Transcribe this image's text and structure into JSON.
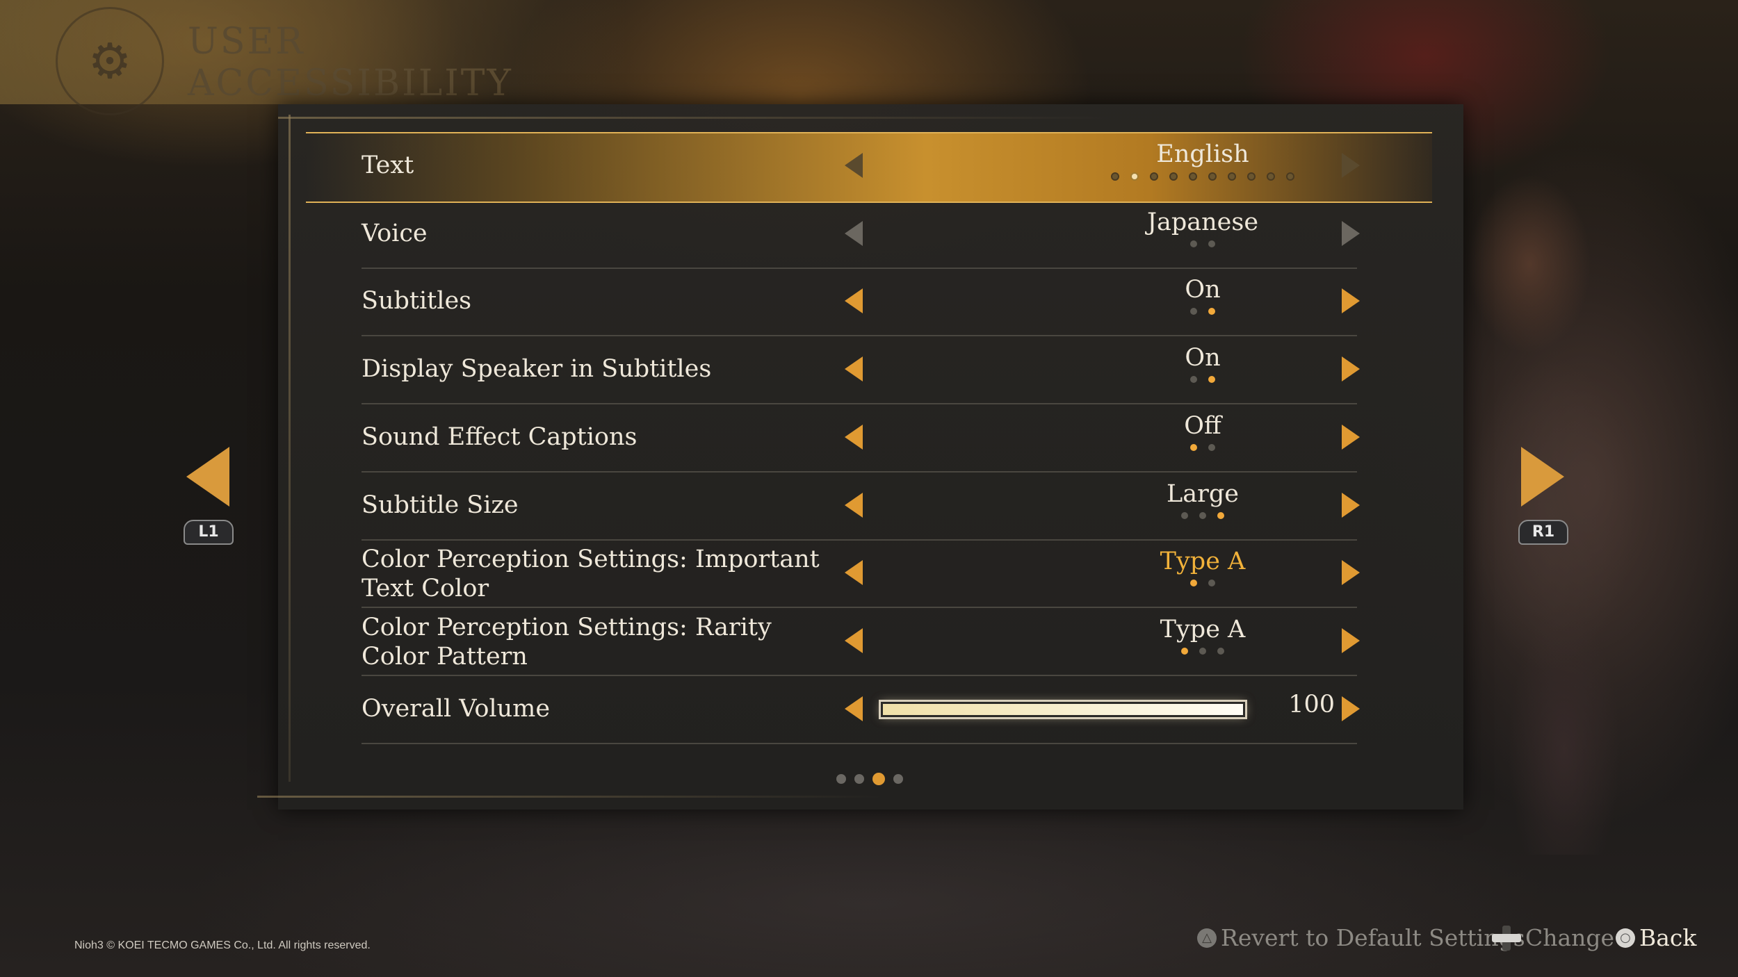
{
  "header": {
    "title": "USER ACCESSIBILITY",
    "emblem_icon": "gear-icon"
  },
  "settings": [
    {
      "label": "Text",
      "value": "English",
      "option_count": 10,
      "option_index": 1,
      "selected": true
    },
    {
      "label": "Voice",
      "value": "Japanese",
      "option_count": 2,
      "option_index": null,
      "selected": false,
      "dim": true
    },
    {
      "label": "Subtitles",
      "value": "On",
      "option_count": 2,
      "option_index": 1,
      "selected": false
    },
    {
      "label": "Display Speaker in Subtitles",
      "value": "On",
      "option_count": 2,
      "option_index": 1,
      "selected": false
    },
    {
      "label": "Sound Effect Captions",
      "value": "Off",
      "option_count": 2,
      "option_index": 0,
      "selected": false
    },
    {
      "label": "Subtitle Size",
      "value": "Large",
      "option_count": 3,
      "option_index": 2,
      "selected": false
    },
    {
      "label": "Color Perception Settings: Important Text Color",
      "value": "Type A",
      "option_count": 2,
      "option_index": 0,
      "selected": false,
      "highlight": true
    },
    {
      "label": "Color Perception Settings: Rarity Color Pattern",
      "value": "Type A",
      "option_count": 3,
      "option_index": 0,
      "selected": false
    },
    {
      "label": "Overall Volume",
      "value": "100",
      "type": "slider",
      "level_percent": 100
    }
  ],
  "pagination": {
    "pages": 4,
    "current": 2
  },
  "nav": {
    "prev_button": "L1",
    "next_button": "R1"
  },
  "footer": {
    "copyright": "Nioh3 © KOEI TECMO GAMES Co., Ltd. All rights reserved.",
    "revert_label": "Revert to Default Settings",
    "change_label": "Change",
    "back_label": "Back"
  },
  "colors": {
    "accent": "#e09a32",
    "highlight_text": "#f2b23a",
    "selection": "#c8902e"
  }
}
